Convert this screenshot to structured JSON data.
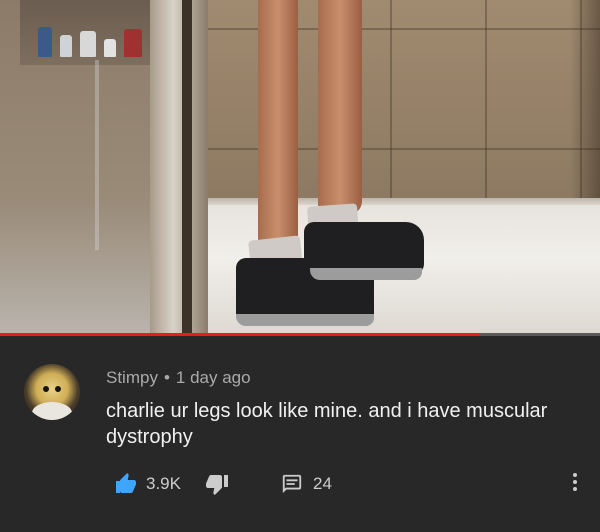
{
  "comment": {
    "author": "Stimpy",
    "separator": "•",
    "time_ago": "1 day ago",
    "text": "charlie ur legs look like mine. and i have muscular dystrophy",
    "like_count": "3.9K",
    "reply_count": "24",
    "icons": {
      "like": "thumbs-up-icon",
      "dislike": "thumbs-down-icon",
      "reply": "comment-icon",
      "more": "more-vert-icon"
    }
  },
  "video": {
    "progress": 0.8
  },
  "colors": {
    "background": "#282828",
    "like_active": "#3ea6ff",
    "progress": "#e02020",
    "meta_text": "#aaaaaa",
    "body_text": "#f1f1f1"
  }
}
